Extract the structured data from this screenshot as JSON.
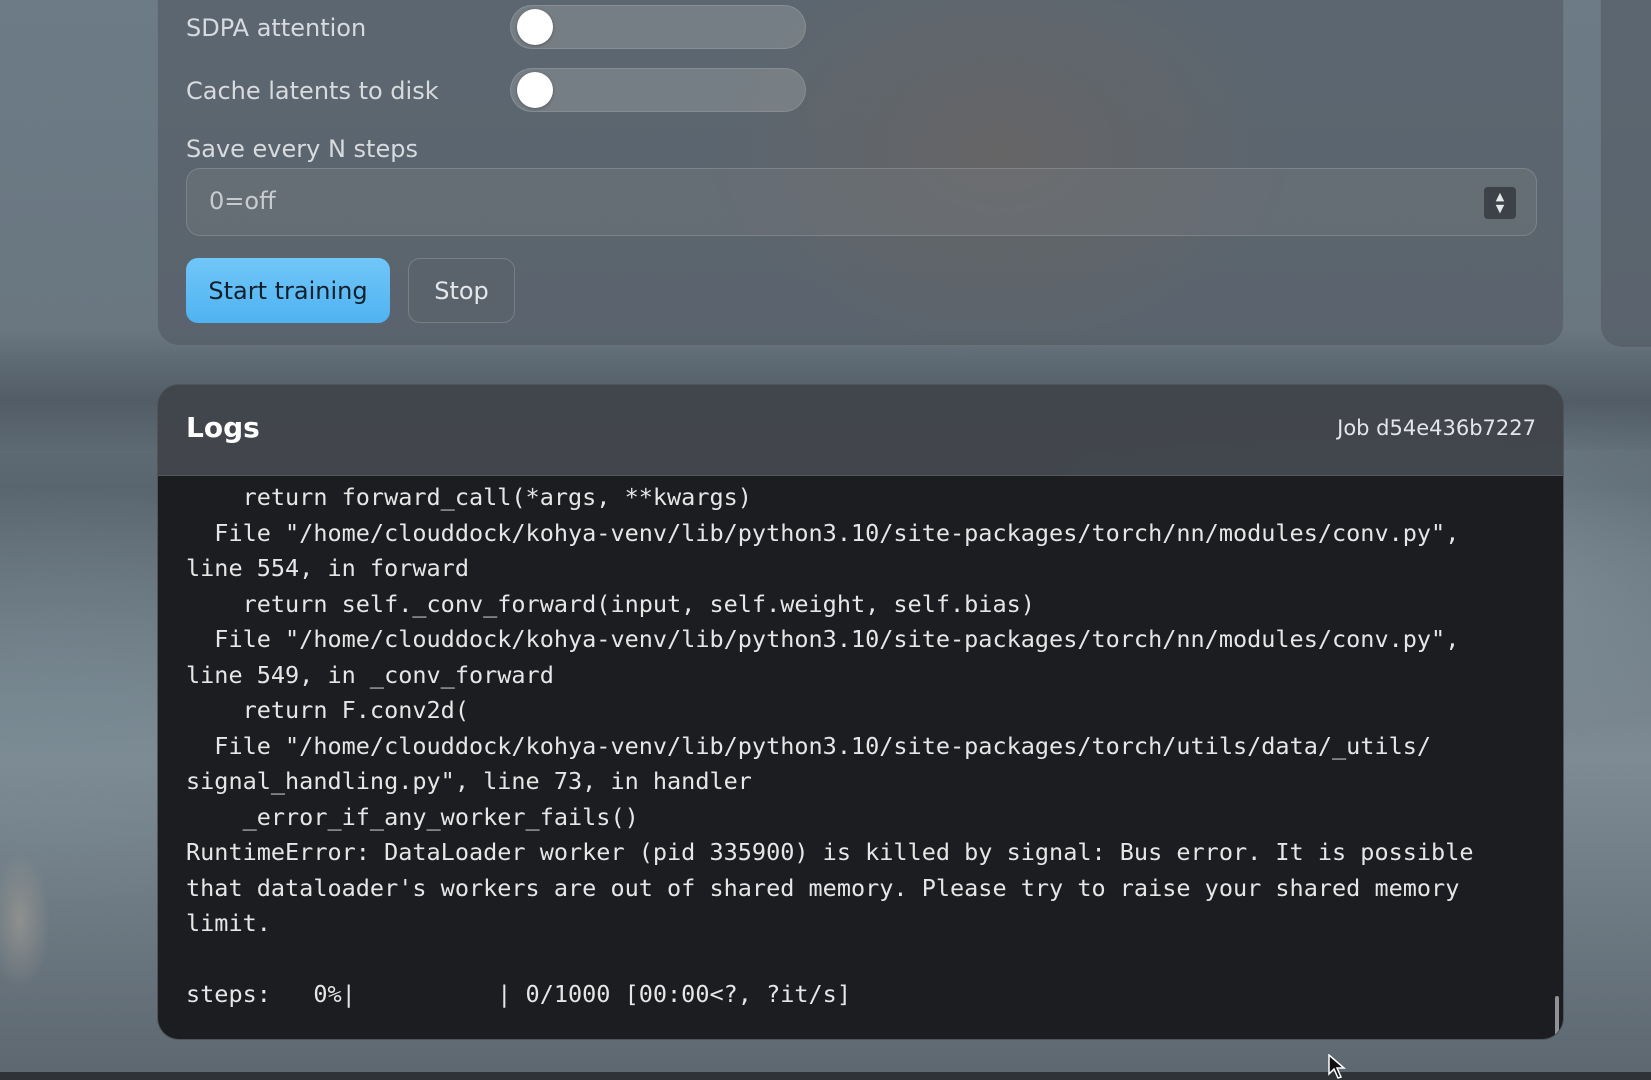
{
  "settings": {
    "sdpa_label": "SDPA attention",
    "cache_label": "Cache latents to disk",
    "save_every_label": "Save every N steps",
    "save_every_placeholder": "0=off",
    "sdpa_enabled": false,
    "cache_enabled": false
  },
  "actions": {
    "start_label": "Start training",
    "stop_label": "Stop"
  },
  "logs": {
    "title": "Logs",
    "job_id": "Job d54e436b7227",
    "lines": [
      "    return forward_call(*args, **kwargs)",
      "  File \"/home/clouddock/kohya-venv/lib/python3.10/site-packages/torch/nn/modules/conv.py\",",
      "line 554, in forward",
      "    return self._conv_forward(input, self.weight, self.bias)",
      "  File \"/home/clouddock/kohya-venv/lib/python3.10/site-packages/torch/nn/modules/conv.py\",",
      "line 549, in _conv_forward",
      "    return F.conv2d(",
      "  File \"/home/clouddock/kohya-venv/lib/python3.10/site-packages/torch/utils/data/_utils/",
      "signal_handling.py\", line 73, in handler",
      "    _error_if_any_worker_fails()",
      "RuntimeError: DataLoader worker (pid 335900) is killed by signal: Bus error. It is possible",
      "that dataloader's workers are out of shared memory. Please try to raise your shared memory",
      "limit.",
      "",
      "steps:   0%|          | 0/1000 [00:00<?, ?it/s]"
    ]
  },
  "icons": {
    "spinner": "spinner-up-down-icon",
    "cursor": "mouse-pointer-icon"
  },
  "colors": {
    "primary_button": "#5bbcf4",
    "log_background": "#1c1d20"
  }
}
